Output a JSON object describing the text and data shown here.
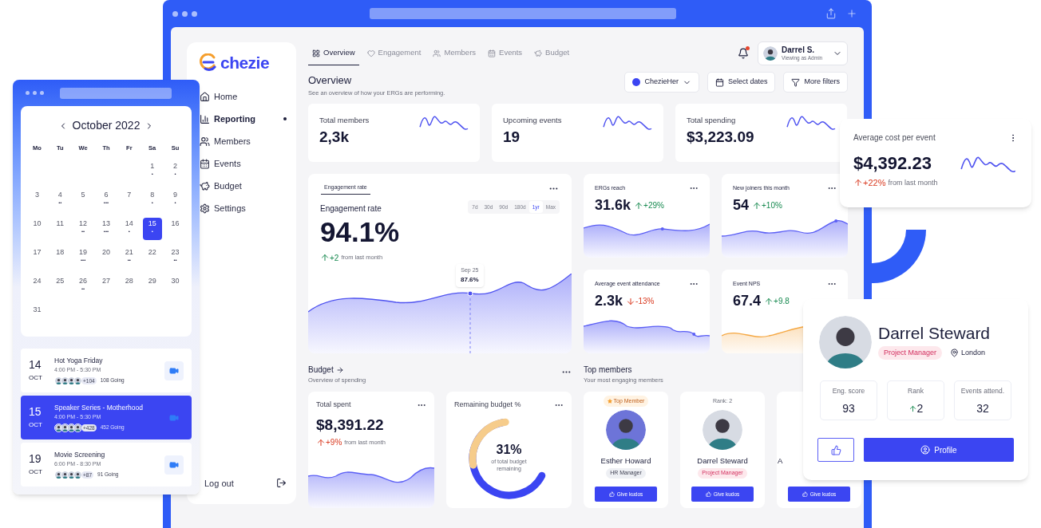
{
  "main_window": {
    "logo": "chezie",
    "nav": [
      {
        "label": "Home",
        "selected": false
      },
      {
        "label": "Reporting",
        "selected": true
      },
      {
        "label": "Members",
        "selected": false
      },
      {
        "label": "Events",
        "selected": false
      },
      {
        "label": "Budget",
        "selected": false
      },
      {
        "label": "Settings",
        "selected": false
      }
    ],
    "logout": "Log out",
    "tabs": [
      {
        "label": "Overview",
        "selected": true
      },
      {
        "label": "Engagement",
        "selected": false
      },
      {
        "label": "Members",
        "selected": false
      },
      {
        "label": "Events",
        "selected": false
      },
      {
        "label": "Budget",
        "selected": false
      }
    ],
    "notifications": {
      "unread": true
    },
    "user": {
      "name": "Darrel S.",
      "subtitle": "Viewing as Admin"
    },
    "title": "Overview",
    "subtitle": "See an overview of how your ERGs are performing.",
    "filters": [
      "ChezieHer",
      "Select dates",
      "More filters"
    ],
    "stats": [
      {
        "label": "Total members",
        "value": "2,3k"
      },
      {
        "label": "Upcoming events",
        "value": "19"
      },
      {
        "label": "Total spending",
        "value": "$3,223.09"
      }
    ],
    "engagement": {
      "tab": "Engagement rate",
      "label": "Engagement rate",
      "value": "94.1%",
      "change": "+2",
      "rising": true,
      "positive": true,
      "note": "from last month",
      "ranges": [
        {
          "label": "7d",
          "selected": false
        },
        {
          "label": "30d",
          "selected": false
        },
        {
          "label": "90d",
          "selected": false
        },
        {
          "label": "180d",
          "selected": false
        },
        {
          "label": "1yr",
          "selected": true
        },
        {
          "label": "Max",
          "selected": false
        }
      ],
      "tooltip": {
        "date": "Sep 25",
        "value": "87.6%"
      }
    },
    "metrics": [
      {
        "label": "ERGs reach",
        "value": "31.6k",
        "change": "+29%",
        "rising": true,
        "positive": true,
        "color": "#5b5ff5"
      },
      {
        "label": "New joiners this month",
        "value": "54",
        "change": "+10%",
        "rising": true,
        "positive": true,
        "color": "#5b5ff5"
      },
      {
        "label": "Average event attendance",
        "value": "2.3k",
        "change": "-13%",
        "rising": false,
        "positive": false,
        "color": "#5b5ff5"
      },
      {
        "label": "Event NPS",
        "value": "67.4",
        "change": "+9.8",
        "rising": true,
        "positive": true,
        "color": "#f5a742"
      }
    ],
    "budget": {
      "title": "Budget",
      "subtitle": "Overview of spending",
      "total": {
        "label": "Total spent",
        "value": "$8,391.22",
        "change": "+9%",
        "rising": true,
        "positive": false,
        "note": "from last month"
      },
      "remaining": {
        "label": "Remaining budget %",
        "value": "31%",
        "note": "of total budget remaining",
        "level": 0.31
      }
    },
    "top_members": {
      "title": "Top members",
      "subtitle": "Your most engaging members",
      "members": [
        {
          "badge": "Top Member",
          "kind": "top",
          "name": "Esther Howard",
          "role": "HR Manager",
          "color": "#eef0f4",
          "button": "Give kudos"
        },
        {
          "badge": "Rank: 2",
          "kind": "rank",
          "name": "Darrel Steward",
          "role": "Project Manager",
          "color": "#fde8ec",
          "button": "Give kudos"
        },
        {
          "kind": "plain",
          "name": "A",
          "button": "Give kudos"
        }
      ]
    }
  },
  "calendar_window": {
    "month": "October 2022",
    "weekdays": [
      "Mo",
      "Tu",
      "We",
      "Th",
      "Fr",
      "Sa",
      "Su"
    ],
    "days": [
      {
        "day": "1",
        "marks": "•",
        "selected": false
      },
      {
        "day": "2",
        "marks": "•",
        "selected": false
      },
      {
        "day": "3",
        "selected": false
      },
      {
        "day": "4",
        "marks": "••",
        "selected": false
      },
      {
        "day": "5",
        "selected": false
      },
      {
        "day": "6",
        "marks": "•••",
        "selected": false
      },
      {
        "day": "7",
        "selected": false
      },
      {
        "day": "8",
        "marks": "•",
        "selected": false
      },
      {
        "day": "9",
        "marks": "•",
        "selected": false
      },
      {
        "day": "10",
        "selected": false
      },
      {
        "day": "11",
        "selected": false
      },
      {
        "day": "12",
        "marks": "••",
        "selected": false
      },
      {
        "day": "13",
        "marks": "•••",
        "selected": false
      },
      {
        "day": "14",
        "marks": "•",
        "selected": false
      },
      {
        "day": "15",
        "marks": "•",
        "selected": true
      },
      {
        "day": "16",
        "selected": false
      },
      {
        "day": "17",
        "selected": false
      },
      {
        "day": "18",
        "selected": false
      },
      {
        "day": "19",
        "marks": "•••",
        "selected": false
      },
      {
        "day": "20",
        "selected": false
      },
      {
        "day": "21",
        "marks": "••",
        "selected": false
      },
      {
        "day": "22",
        "selected": false
      },
      {
        "day": "23",
        "marks": "••",
        "selected": false
      },
      {
        "day": "24",
        "selected": false
      },
      {
        "day": "25",
        "selected": false
      },
      {
        "day": "26",
        "marks": "••",
        "selected": false
      },
      {
        "day": "27",
        "selected": false
      },
      {
        "day": "28",
        "selected": false
      },
      {
        "day": "29",
        "selected": false
      },
      {
        "day": "30",
        "selected": false
      },
      {
        "day": "31",
        "selected": false
      }
    ],
    "events": [
      {
        "day": "14",
        "month": "OCT",
        "title": "Hot Yoga Friday",
        "time": "4:00 PM - 5:30 PM",
        "extra": "+104",
        "going": "108 Going",
        "selected": false
      },
      {
        "day": "15",
        "month": "OCT",
        "title": "Speaker Series - Motherhood",
        "time": "4:00 PM - 5:30 PM",
        "extra": "+428",
        "going": "452 Going",
        "selected": true
      },
      {
        "day": "19",
        "month": "OCT",
        "title": "Movie Screening",
        "time": "6:00 PM - 8:30 PM",
        "extra": "+87",
        "going": "91 Going",
        "selected": false
      }
    ]
  },
  "avg_cost_card": {
    "label": "Average cost per event",
    "value": "$4,392.23",
    "change": "+22%",
    "rising": true,
    "positive": false,
    "note": "from last month"
  },
  "profile_card": {
    "name": "Darrel Steward",
    "role": "Project Manager",
    "location": "London",
    "stats": [
      {
        "label": "Eng. score",
        "value": "93",
        "rising": false
      },
      {
        "label": "Rank",
        "value": "2",
        "rising": true
      },
      {
        "label": "Events attend.",
        "value": "32",
        "rising": false
      }
    ],
    "button": "Profile"
  }
}
